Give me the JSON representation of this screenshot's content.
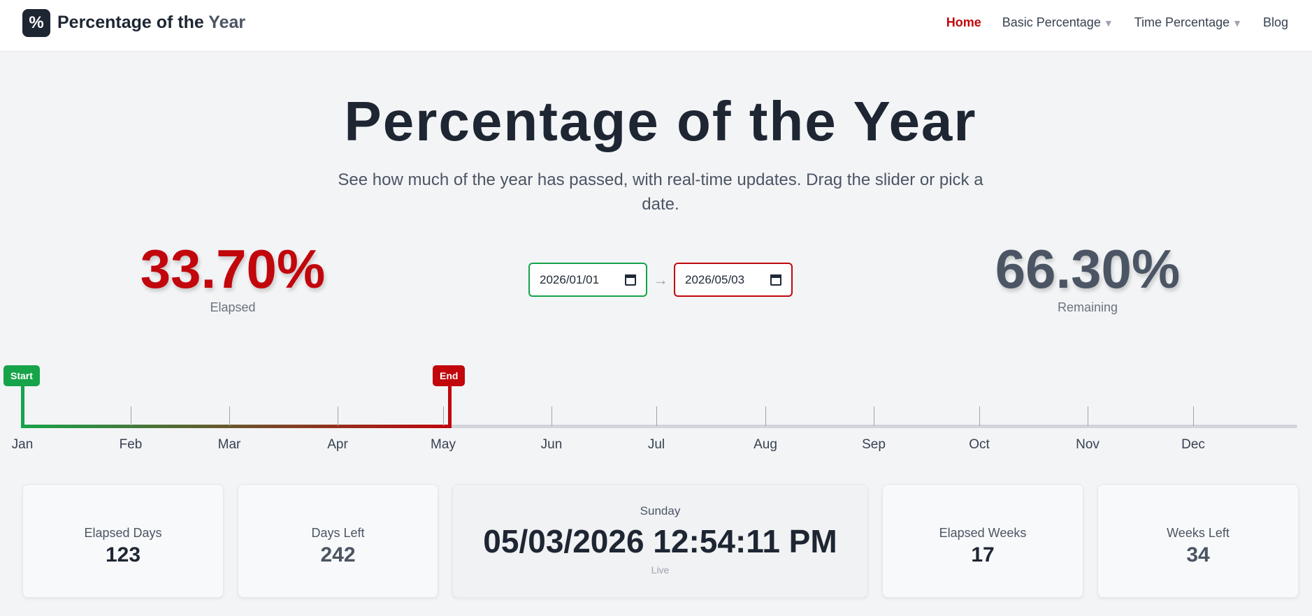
{
  "nav": {
    "logo_glyph": "%",
    "brand_main": "Percentage of the ",
    "brand_accent": "Year",
    "links": [
      {
        "label": "Home",
        "active": true
      },
      {
        "label": "Basic Percentage",
        "dropdown": true
      },
      {
        "label": "Time Percentage",
        "dropdown": true
      },
      {
        "label": "Blog"
      }
    ]
  },
  "hero": {
    "title": "Percentage of the Year",
    "subtitle": "See how much of the year has passed, with real-time updates. Drag the slider or pick a date."
  },
  "elapsed": {
    "value": "33.70%",
    "label": "Elapsed"
  },
  "remaining": {
    "value": "66.30%",
    "label": "Remaining"
  },
  "dates": {
    "start": "2026/01/01",
    "end": "2026/05/03",
    "arrow": "→"
  },
  "timeline": {
    "start_label": "Start",
    "end_label": "End",
    "months": [
      "Jan",
      "Feb",
      "Mar",
      "Apr",
      "May",
      "Jun",
      "Jul",
      "Aug",
      "Sep",
      "Oct",
      "Nov",
      "Dec"
    ],
    "progress_fraction": 0.337,
    "colors": {
      "start": "#16a34a",
      "end": "#c1060c",
      "track": "#d1d5db"
    }
  },
  "stats": {
    "elapsed_days": {
      "label": "Elapsed Days",
      "value": "123"
    },
    "days_left": {
      "label": "Days Left",
      "value": "242"
    },
    "clock": {
      "day": "Sunday",
      "time": "05/03/2026 12:54:11 PM",
      "status": "Live"
    },
    "elapsed_weeks": {
      "label": "Elapsed Weeks",
      "value": "17"
    },
    "weeks_left": {
      "label": "Weeks Left",
      "value": "34"
    }
  }
}
